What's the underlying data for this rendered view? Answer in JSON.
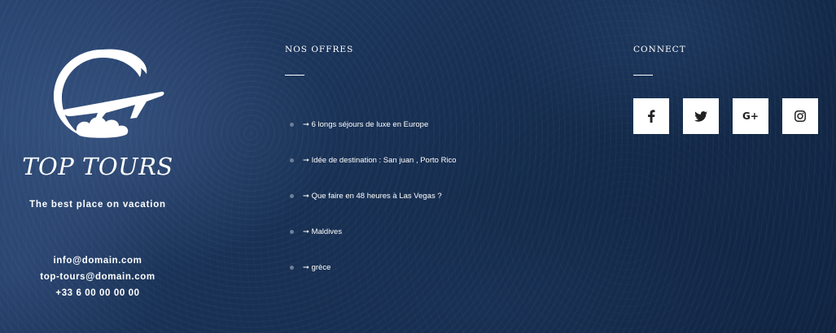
{
  "brand": {
    "logo_icon": "plane-swoosh-logo",
    "name": "TOP TOURS",
    "tagline": "The best place on vacation",
    "contact": [
      "info@domain.com",
      "top-tours@domain.com",
      "+33 6 00 00 00 00"
    ]
  },
  "offers": {
    "title": "NOS OFFRES",
    "items": [
      "➞ 6 longs séjours de luxe en Europe",
      "➞ Idée de destination : San juan , Porto Rico",
      "➞ Que faire en 48 heures à Las Vegas ?",
      "➞ Maldives",
      "➞ grèce"
    ]
  },
  "connect": {
    "title": "CONNECT",
    "social": [
      {
        "name": "facebook-icon"
      },
      {
        "name": "twitter-icon"
      },
      {
        "name": "google-plus-icon",
        "glyph": "G+"
      },
      {
        "name": "instagram-icon"
      }
    ]
  },
  "colors": {
    "background": "#1a3358",
    "text": "#ffffff",
    "social_button_bg": "#ffffff",
    "social_icon": "#222222",
    "bullet": "#6d7f99"
  }
}
